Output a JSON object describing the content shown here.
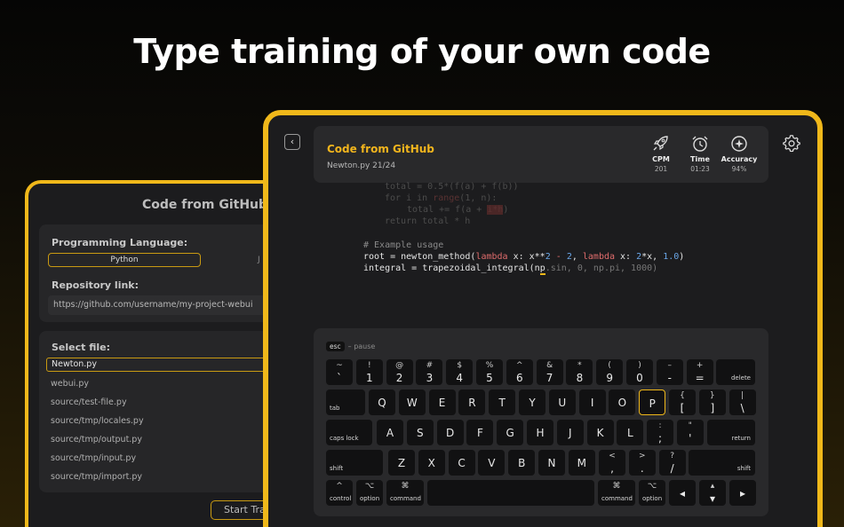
{
  "headline": "Type training of your own code",
  "back_screen": {
    "title": "Code from GitHub",
    "language_label": "Programming Language:",
    "language_options": [
      "Python",
      "J"
    ],
    "repo_label": "Repository link:",
    "repo_url": "https://github.com/username/my-project-webui",
    "select_file_label": "Select file:",
    "files": [
      "Newton.py",
      "webui.py",
      "source/test-file.py",
      "source/tmp/locales.py",
      "source/tmp/output.py",
      "source/tmp/input.py",
      "source/tmp/import.py"
    ],
    "start_button": "Start Tra"
  },
  "front_screen": {
    "back_icon": "chevron-left-icon",
    "settings_icon": "gear-icon",
    "title": "Code from GitHub",
    "subtitle": "Newton.py 21/24",
    "stats": [
      {
        "icon": "rocket-icon",
        "label": "CPM",
        "value": "201"
      },
      {
        "icon": "alarm-clock-icon",
        "label": "Time",
        "value": "01:23"
      },
      {
        "icon": "target-icon",
        "label": "Accuracy",
        "value": "94%"
      }
    ],
    "code": {
      "line1": "total = 0.5*(f(a) + f(b))",
      "line2": [
        "for i in ",
        "range",
        "(1, n):"
      ],
      "line3": [
        "total += f(a + ",
        "i*h",
        ")"
      ],
      "line4": "return total * h",
      "comment": "# Example usage",
      "line6": [
        "root = newton_method(",
        "lambda",
        " x: x**",
        "2",
        " - ",
        "2",
        ", ",
        "lambda",
        " x: ",
        "2",
        "*x, ",
        "1.0",
        ")"
      ],
      "line7_typed": "integral = trapezoidal_integral(n",
      "line7_cursor": "p",
      "line7_pending": ".sin, 0, np.pi, 1000)"
    },
    "keyboard": {
      "esc": "esc",
      "esc_hint": "– pause",
      "highlighted_key": "P",
      "row1": [
        [
          "~",
          "`"
        ],
        [
          "!",
          "1"
        ],
        [
          "@",
          "2"
        ],
        [
          "#",
          "3"
        ],
        [
          "$",
          "4"
        ],
        [
          "%",
          "5"
        ],
        [
          "^",
          "6"
        ],
        [
          "&",
          "7"
        ],
        [
          "*",
          "8"
        ],
        [
          "(",
          "9"
        ],
        [
          ")",
          "0"
        ],
        [
          "–",
          "-"
        ],
        [
          "+",
          "="
        ]
      ],
      "delete": "delete",
      "tab": "tab",
      "row2": [
        "Q",
        "W",
        "E",
        "R",
        "T",
        "Y",
        "U",
        "I",
        "O",
        "P"
      ],
      "row2_sym": [
        [
          "{",
          "["
        ],
        [
          "}",
          "]"
        ],
        [
          "|",
          "\\"
        ]
      ],
      "caps": "caps lock",
      "row3": [
        "A",
        "S",
        "D",
        "F",
        "G",
        "H",
        "J",
        "K",
        "L"
      ],
      "row3_sym": [
        [
          ":",
          ";"
        ],
        [
          "\"",
          "'"
        ]
      ],
      "return": "return",
      "shift": "shift",
      "row4": [
        "Z",
        "X",
        "C",
        "V",
        "B",
        "N",
        "M"
      ],
      "row4_sym": [
        [
          "<",
          ","
        ],
        [
          ">",
          "."
        ],
        [
          "?",
          "/"
        ]
      ],
      "control_sym": "^",
      "control": "control",
      "option_sym": "⌥",
      "option": "option",
      "command_sym": "⌘",
      "command": "command",
      "arrows": [
        "◂",
        "▴",
        "▾",
        "▸"
      ]
    }
  }
}
